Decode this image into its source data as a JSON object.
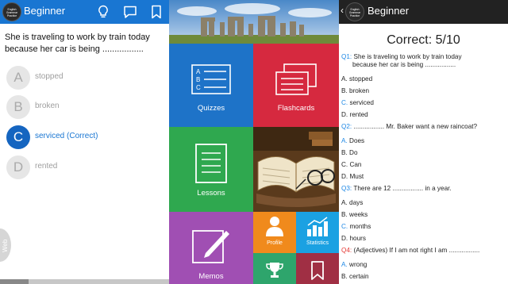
{
  "left": {
    "app_logo_text": "English Grammar Practice",
    "title": "Beginner",
    "question": "She is traveling to work by train today because her car is being .................",
    "options": [
      {
        "letter": "A",
        "text": "stopped"
      },
      {
        "letter": "B",
        "text": "broken"
      },
      {
        "letter": "C",
        "text": "serviced (Correct)"
      },
      {
        "letter": "D",
        "text": "rented"
      }
    ],
    "web_tab": "Web",
    "colors": {
      "toolbar": "#1976d2",
      "selected": "#1565c0"
    }
  },
  "middle": {
    "tiles": {
      "quizzes": "Quizzes",
      "flashcards": "Flashcards",
      "lessons": "Lessons",
      "memos": "Memos",
      "profile": "Profile",
      "statistics": "Statistics"
    },
    "quiz_icon_letters": [
      "A",
      "B",
      "C"
    ],
    "colors": {
      "quizzes": "#1e73c8",
      "flashcards": "#d6293f",
      "lessons": "#2fa84f",
      "memos": "#a04fb3",
      "profile": "#f08a1c",
      "statistics": "#1ba1e2",
      "trophy": "#2ea56c",
      "bookmark": "#a02f44"
    },
    "icons": [
      "stonehenge-photo",
      "quiz-list-icon",
      "flashcards-icon",
      "lessons-document-icon",
      "open-book-photo",
      "memo-pencil-icon",
      "person-icon",
      "bar-chart-icon",
      "trophy-icon",
      "bookmark-icon"
    ]
  },
  "right": {
    "app_logo_text": "English Grammar Practice",
    "back": "‹",
    "title": "Beginner",
    "score": "Correct: 5/10",
    "results": [
      {
        "num": "Q1:",
        "text": "She is traveling to work by train today",
        "cont": "because her car is being .................",
        "num_color": "blue",
        "options": [
          {
            "letter": "A.",
            "text": "stopped",
            "highlight": false
          },
          {
            "letter": "B.",
            "text": "broken",
            "highlight": false
          },
          {
            "letter": "C.",
            "text": "serviced",
            "highlight": true
          },
          {
            "letter": "D.",
            "text": "rented",
            "highlight": false
          }
        ]
      },
      {
        "num": "Q2:",
        "text": "................. Mr. Baker want a new raincoat?",
        "num_color": "blue",
        "options": [
          {
            "letter": "A.",
            "text": "Does",
            "highlight": true
          },
          {
            "letter": "B.",
            "text": "Do",
            "highlight": false
          },
          {
            "letter": "C.",
            "text": "Can",
            "highlight": false
          },
          {
            "letter": "D.",
            "text": "Must",
            "highlight": false
          }
        ]
      },
      {
        "num": "Q3:",
        "text": "There are 12 ................. in a year.",
        "num_color": "blue",
        "options": [
          {
            "letter": "A.",
            "text": "days",
            "highlight": false
          },
          {
            "letter": "B.",
            "text": "weeks",
            "highlight": false
          },
          {
            "letter": "C.",
            "text": "months",
            "highlight": true
          },
          {
            "letter": "D.",
            "text": "hours",
            "highlight": false
          }
        ]
      },
      {
        "num": "Q4:",
        "text": "(Adjectives) If I am not right I am .................",
        "num_color": "red",
        "options": [
          {
            "letter": "A.",
            "text": "wrong",
            "highlight": true
          },
          {
            "letter": "B.",
            "text": "certain",
            "highlight": false
          }
        ]
      }
    ]
  },
  "icons": [
    "logo-icon",
    "lightbulb-icon",
    "comment-icon",
    "bookmark-icon",
    "back-chevron-icon"
  ]
}
